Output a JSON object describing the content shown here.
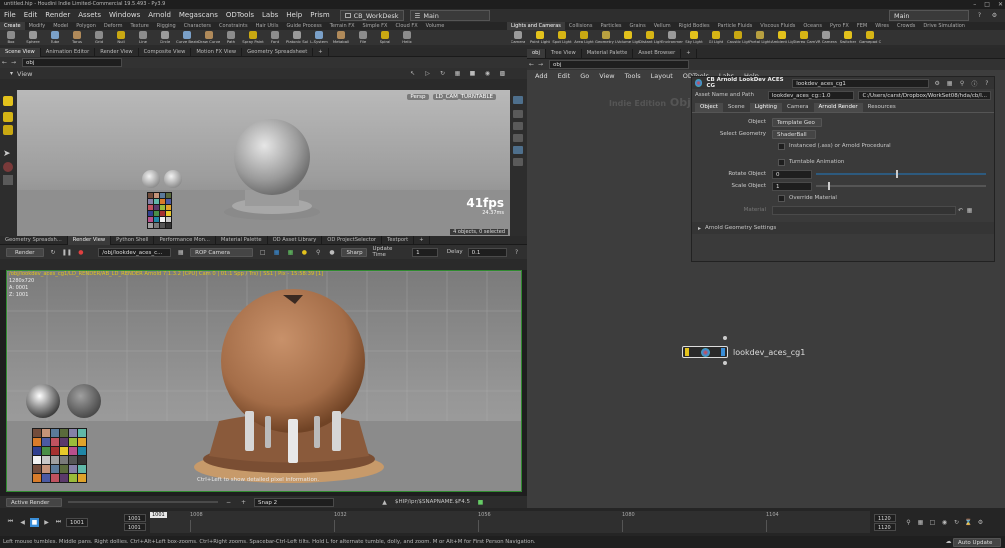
{
  "window": {
    "title": "untitled.hip - Houdini Indie Limited-Commercial 19.5.493 - Py3.9"
  },
  "menubar": {
    "items": [
      "File",
      "Edit",
      "Render",
      "Assets",
      "Windows",
      "Arnold",
      "Megascans",
      "ODTools",
      "Labs",
      "Help",
      "Prism"
    ],
    "desktop_left": "CB_WorkDesk",
    "desktop_mid": "Main",
    "desktop_right": "Main"
  },
  "shelf_left": {
    "tabs": [
      "Create",
      "Modify",
      "Model",
      "Polygon",
      "Deform",
      "Texture",
      "Rigging",
      "Characters",
      "Constraints",
      "Hair Utils",
      "Guide Process",
      "Terrain FX",
      "Simple FX",
      "Cloud FX",
      "Volume"
    ],
    "tools": [
      "Box",
      "Sphere",
      "Tube",
      "Torus",
      "Grid",
      "Null",
      "Line",
      "Circle",
      "Curve Bezier",
      "Draw Curve",
      "Path",
      "Spray Paint",
      "Font",
      "Platonic Solids",
      "L-System",
      "Metaball",
      "File",
      "Spiral",
      "Helix"
    ]
  },
  "shelf_right": {
    "tabs": [
      "Lights and Cameras",
      "Collisions",
      "Particles",
      "Grains",
      "Vellum",
      "Rigid Bodies",
      "Particle Fluids",
      "Viscous Fluids",
      "Oceans",
      "Pyro FX",
      "FEM",
      "Wires",
      "Crowds",
      "Drive Simulation"
    ],
    "tools": [
      "Camera",
      "Point Light",
      "Spot Light",
      "Area Light",
      "Geometry Light",
      "Volume Light",
      "Distant Light",
      "Environment Light",
      "Sky Light",
      "GI Light",
      "Caustic Light",
      "Portal Light",
      "Ambient Light",
      "Stereo Camera",
      "VR Camera",
      "Switcher",
      "Gamepad Camera"
    ]
  },
  "scene_pane": {
    "tabs": [
      "Scene View",
      "Animation Editor",
      "Render View",
      "Composite View",
      "Motion FX View",
      "Geometry Spreadsheet"
    ],
    "path": "obj",
    "view_label": "View",
    "persp": "Persp",
    "camera": "LD_CAM_TURNTABLE",
    "fps": "41fps",
    "ms": "24.37ms",
    "selection": "4 objects, 0 selected"
  },
  "render_pane": {
    "tabs": [
      "Geometry Spreadsh...",
      "Render View",
      "Python Shell",
      "Performance Mon...",
      "Material Palette",
      "OD Asset Library",
      "OD ProjectSelector",
      "Textport"
    ],
    "render_button": "Render",
    "node_path": "/obj/lookdev_aces_c...",
    "camera": "ROP Camera",
    "sharp": "Sharp",
    "update_time_label": "Update Time",
    "update_time": "1",
    "delay_label": "Delay",
    "delay": "0.1",
    "overlay_line": "/obj/lookdev_aces_cg1/LD_RENDER/AB_LD_RENDER  Arnold 7.1.3.2 [CPU]  Cam 0 | 01:1 Spp / Trs) | SS1 | Pix - 15:58:39 [1]",
    "overlay_line2": "1280x720",
    "overlay_line3": "A: 0001",
    "overlay_line4": "Z: 1001",
    "hint": "Ctrl+Left to show detailed pixel information.",
    "active_render": "Active Render",
    "snap": "Snap 2",
    "save_path": "$HIP/ipr/$SNAPNAME.$F4.5"
  },
  "network_pane": {
    "tabs": [
      "obj",
      "Tree View",
      "Material Palette",
      "Asset Browser"
    ],
    "path": "obj",
    "menu": [
      "Add",
      "Edit",
      "Go",
      "View",
      "Tools",
      "Layout",
      "ODTools",
      "Labs",
      "Help"
    ],
    "watermark_1": "Indie Edition",
    "watermark_2": "Objects",
    "node_name": "lookdev_aces_cg1"
  },
  "params": {
    "node_type": "CB Arnold LookDev ACES CG",
    "node_name": "lookdev_aces_cg1",
    "asset_label": "Asset Name and Path",
    "asset_name": "lookdev_aces_cg::1.0",
    "asset_path": "C:/Users/carst/Dropbox/WorkSet08/hda/cb/l...",
    "tabs": [
      "Object",
      "Scene",
      "Lighting",
      "Camera",
      "Arnold Render",
      "Resources"
    ],
    "object_label": "Object",
    "object_value": "Template Geo",
    "select_geo_label": "Select Geometry",
    "select_geo_value": "ShaderBall",
    "instanced_label": "Instanced (.ass) or Arnold Procedural",
    "turntable_label": "Turntable Animation",
    "rotate_label": "Rotate Object",
    "rotate_value": "0",
    "scale_label": "Scale Object",
    "scale_value": "1",
    "override_label": "Override Material",
    "material_label": "Material",
    "folder_label": "Arnold Geometry Settings"
  },
  "timeline": {
    "frame_current": "1001",
    "start": "1001",
    "start2": "1001",
    "end": "1120",
    "end2": "1120",
    "ticks": [
      "1001",
      "1008",
      "1032",
      "1056",
      "1080",
      "1104"
    ],
    "auto_update": "Auto Update"
  },
  "status": {
    "text": "Left mouse tumbles. Middle pans. Right dollies. Ctrl+Alt+Left box-zooms. Ctrl+Right zooms. Spacebar-Ctrl-Left tilts. Hold L for alternate tumble, dolly, and zoom.     M or Alt+M for First Person Navigation."
  },
  "colors": {
    "accent_yellow": "#e3c21c",
    "render_border": "#2f8b2f",
    "ball_color": "#b07a52"
  }
}
